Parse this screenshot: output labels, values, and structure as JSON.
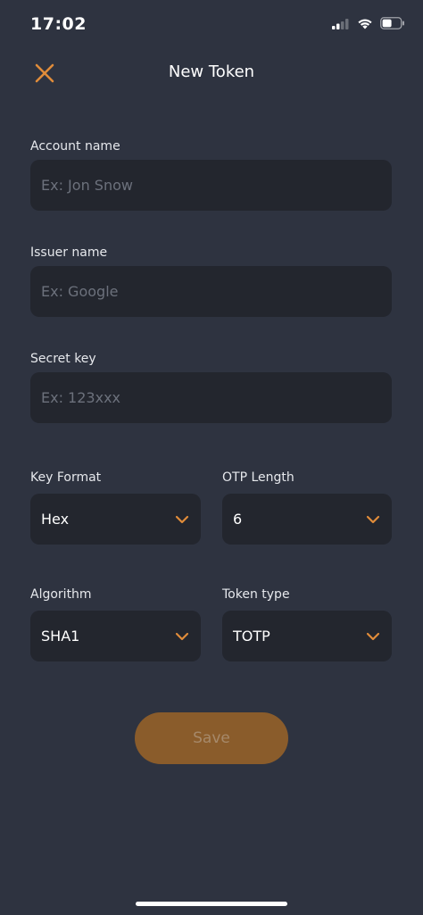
{
  "status_bar": {
    "time": "17:02"
  },
  "header": {
    "title": "New Token",
    "close_icon": "close-x-icon"
  },
  "colors": {
    "background": "#2e3340",
    "field_background": "#23262e",
    "accent": "#e08c3a",
    "save_button": "#8a5c2b",
    "placeholder": "#6c717c"
  },
  "form": {
    "account_name": {
      "label": "Account name",
      "placeholder": "Ex: Jon Snow",
      "value": ""
    },
    "issuer_name": {
      "label": "Issuer name",
      "placeholder": "Ex: Google",
      "value": ""
    },
    "secret_key": {
      "label": "Secret key",
      "placeholder": "Ex: 123xxx",
      "value": ""
    },
    "key_format": {
      "label": "Key Format",
      "value": "Hex"
    },
    "otp_length": {
      "label": "OTP Length",
      "value": "6"
    },
    "algorithm": {
      "label": "Algorithm",
      "value": "SHA1"
    },
    "token_type": {
      "label": "Token type",
      "value": "TOTP"
    }
  },
  "actions": {
    "save_label": "Save"
  }
}
